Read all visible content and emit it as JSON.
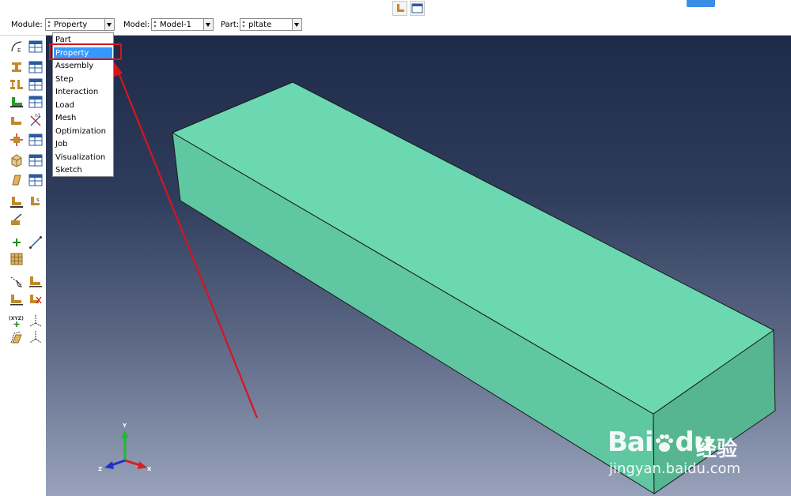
{
  "context_bar": {
    "module_label": "Module:",
    "module_value": "Property",
    "model_label": "Model:",
    "model_value": "Model-1",
    "part_label": "Part:",
    "part_value": "pltate"
  },
  "module_menu": {
    "items": [
      "Part",
      "Property",
      "Assembly",
      "Step",
      "Interaction",
      "Load",
      "Mesh",
      "Optimization",
      "Job",
      "Visualization",
      "Sketch"
    ],
    "selected": "Property"
  },
  "triad": {
    "y": "Y",
    "x": "X",
    "z": "Z"
  },
  "tool_labels": {
    "xyz": "(XYZ)"
  },
  "watermark": {
    "brand_bai": "Bai",
    "brand_du": "du",
    "brand_zh": "经验",
    "url": "jingyan.baidu.com"
  },
  "colors": {
    "part_face_top": "#6bd8b1",
    "part_face_side": "#5fc7a2",
    "part_face_end": "#58b896",
    "annotation": "#d8141c",
    "menu_highlight": "#3399ff",
    "axis_x": "#d42020",
    "axis_y": "#22b833",
    "axis_z": "#2030c8"
  }
}
